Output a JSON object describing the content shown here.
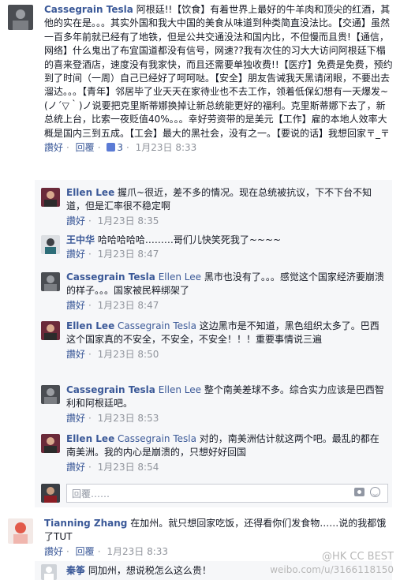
{
  "comments": [
    {
      "author": "Cassegrain Tesla",
      "text": "阿根廷!!【饮食】有着世界上最好的牛羊肉和顶尖的红酒，其他的实在是。。。其实外国和我大中国的美食从味道到种类简直没法比。【交通】虽然一百多年前就已经有了地铁，但是公共交通没法和国内比，不但慢而且贵!【通信，网络】什么鬼出了布宜国道都没有信号，网速??我有次住的习大大访问阿根廷下榻的喜来登酒店，速度没有我家快，而且还需要单独收费!!【医疗】免费是免费，预约到了时间（一周）自己已经好了呵呵哒。【安全】朋友告诫我天黑请闭眼，不要出去溜达。。。【青年】邻居毕了业天天在家待业也不去工作，领着低保幻想有一天爆发~(ノ´▽｀)ノ说要把克里斯蒂娜换掉让新总统能更好的福利。克里斯蒂娜下去了，新总统上台，比索一夜贬值40%。。。幸好劳资带的是美元【工作】雇的本地人效率大概是国内三到五成。【工会】最大的黑社会，没有之一。【要说的话】我想回家〒_〒",
      "meta": {
        "like": "讚好",
        "reply": "回覆",
        "likes": "3",
        "time": "1月23日 8:33"
      }
    },
    {
      "replies": [
        {
          "author": "Ellen Lee",
          "mention": "",
          "text": "握爪~很近，差不多的情况。现在总统被抗议，下不下台不知道，但是汇率很不稳定啊",
          "time": "1月23日 8:35"
        },
        {
          "author": "王中华",
          "mention": "",
          "text": "哈哈哈哈哈………哥们儿快笑死我了~~~~",
          "time": "1月23日 8:47"
        },
        {
          "author": "Cassegrain Tesla",
          "mention": "Ellen Lee",
          "text": "黑市也没有了。。。感觉这个国家经济要崩溃的样子。。。国家被民粹绑架了",
          "time": "1月23日 8:47"
        },
        {
          "author": "Ellen Lee",
          "mention": "Cassegrain Tesla",
          "text": "这边黑市是不知道，黑色组织太多了。巴西这个国家真的不安全，不安全，不安全！！！重要事情说三遍",
          "time": "1月23日 8:50"
        },
        {
          "author": "Cassegrain Tesla",
          "mention": "Ellen Lee",
          "text": "整个南美差球不多。综合实力应该是巴西智利和阿根廷吧。",
          "time": "1月23日 8:53"
        },
        {
          "author": "Ellen Lee",
          "mention": "Cassegrain Tesla",
          "text": "对的，南美洲估计就这两个吧。最乱的都在南美洲。我的内心是崩溃的，只想好好回国",
          "time": "1月23日 8:54"
        }
      ],
      "reply_meta": {
        "like": "讚好",
        "reply": "回覆"
      },
      "reply_placeholder": "回覆……"
    },
    {
      "author": "Tianning Zhang",
      "text": "在加州。就只想回家吃饭，还得看你们发食物……说的我都饿了TUT",
      "meta": {
        "like": "讚好",
        "reply": "回覆",
        "time": "1月23日 8:33"
      }
    },
    {
      "author": "秦筝",
      "text": "同加州，想说税怎么这么贵！"
    }
  ],
  "watermark": {
    "line1": "@HK CC BEST",
    "line2": "weibo.com/u/3166118150"
  },
  "colors": {
    "link": "#3b5998",
    "meta": "#90949c"
  }
}
